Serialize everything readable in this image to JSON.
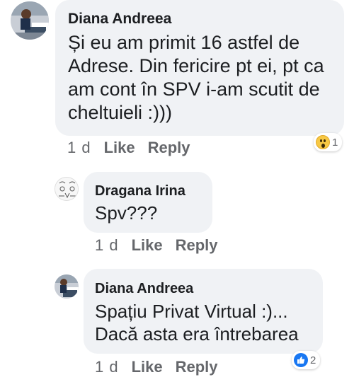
{
  "comments": [
    {
      "author": "Diana Andreea",
      "text": "Și eu am primit 16 astfel de Adrese. Din fericire pt ei, pt ca am cont în SPV i-am scutit de cheltuieli :)))",
      "time": "1 d",
      "like_label": "Like",
      "reply_label": "Reply",
      "reaction": {
        "icon": "wow-reaction-icon",
        "count": "1"
      }
    },
    {
      "author": "Dragana Irina",
      "text": "Spv???",
      "time": "1 d",
      "like_label": "Like",
      "reply_label": "Reply"
    },
    {
      "author": "Diana Andreea",
      "text": "Spațiu Privat Virtual :)... Dacă asta era întrebarea",
      "time": "1 d",
      "like_label": "Like",
      "reply_label": "Reply",
      "reaction": {
        "icon": "like-reaction-icon",
        "count": "2"
      }
    }
  ],
  "colors": {
    "bubble": "#f0f2f5",
    "meta_text": "#65676b",
    "like_blue": "#1877f2",
    "wow_yellow": "#f7c844"
  }
}
